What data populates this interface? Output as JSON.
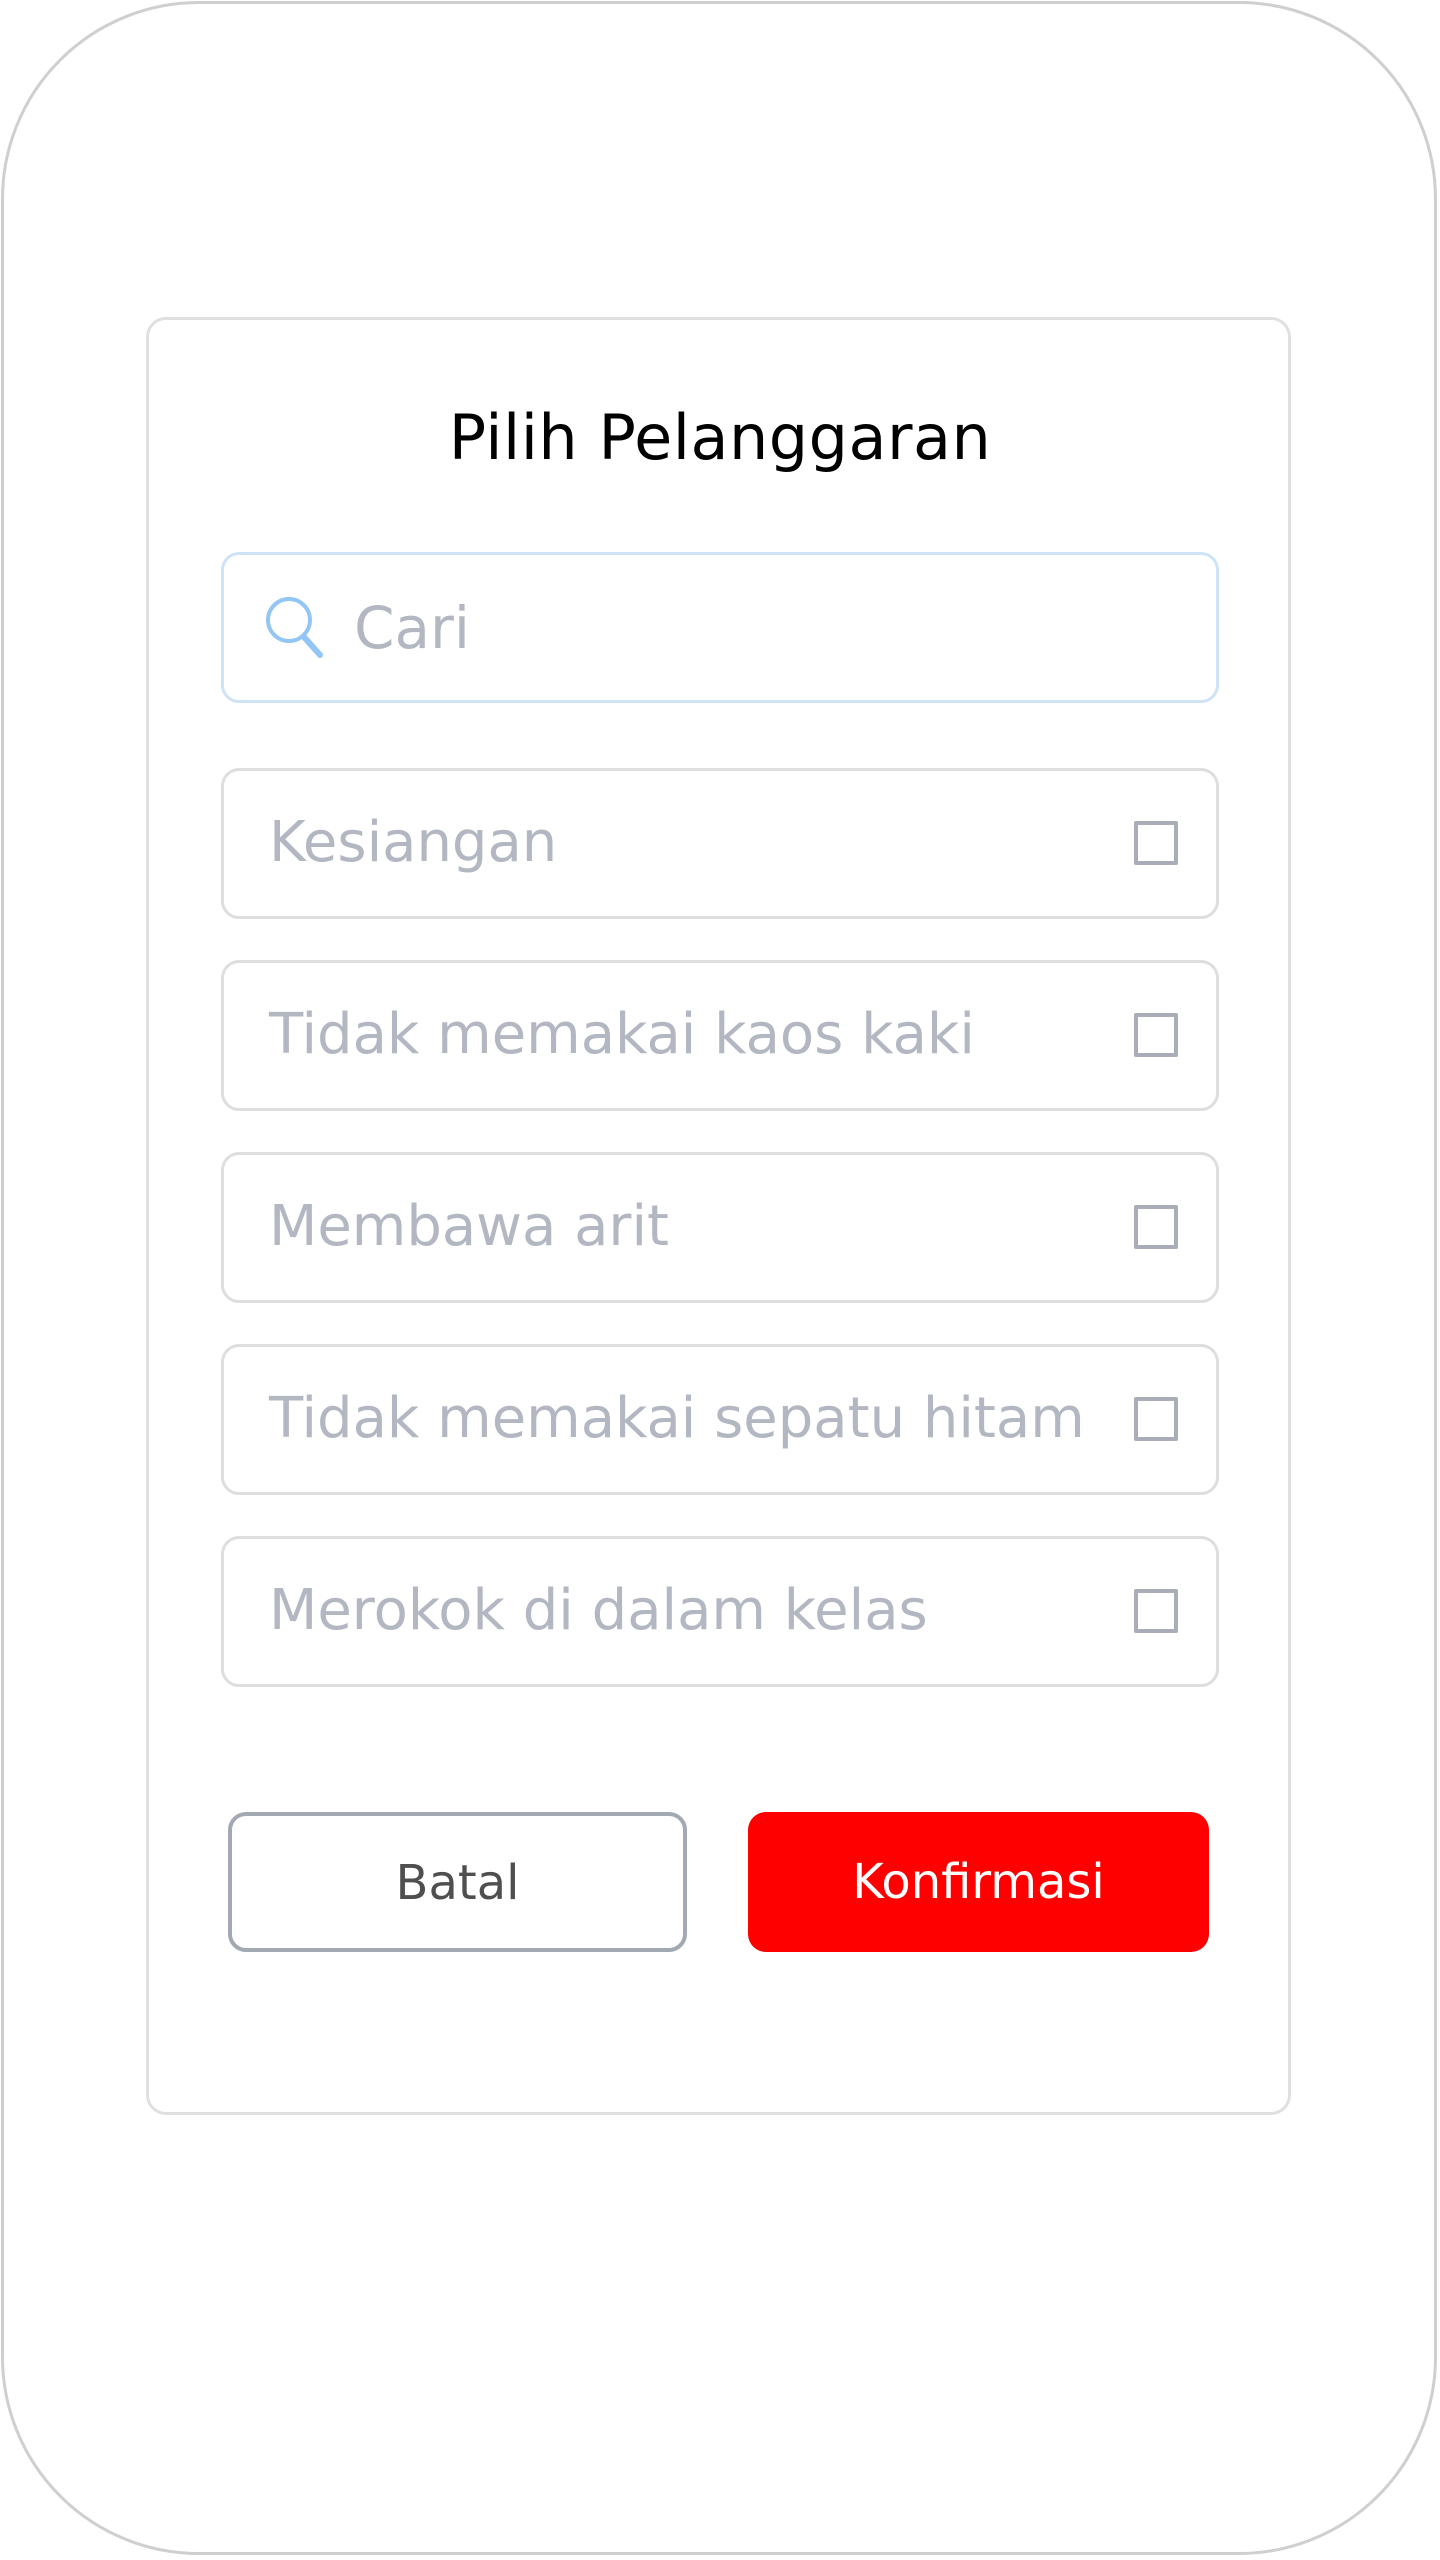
{
  "dialog": {
    "title": "Pilih Pelanggaran"
  },
  "search": {
    "placeholder": "Cari",
    "icon": "search-icon"
  },
  "options": [
    {
      "label": "Kesiangan",
      "checked": false
    },
    {
      "label": "Tidak memakai kaos kaki",
      "checked": false
    },
    {
      "label": "Membawa arit",
      "checked": false
    },
    {
      "label": "Tidak memakai sepatu hitam",
      "checked": false
    },
    {
      "label": "Merokok di dalam kelas",
      "checked": false
    }
  ],
  "buttons": {
    "cancel_label": "Batal",
    "confirm_label": "Konfirmasi"
  },
  "colors": {
    "confirm_background": "#ff0000",
    "search_border": "#cfe3f7",
    "search_icon": "#93c5f5",
    "placeholder_text": "#b3b7c2"
  }
}
